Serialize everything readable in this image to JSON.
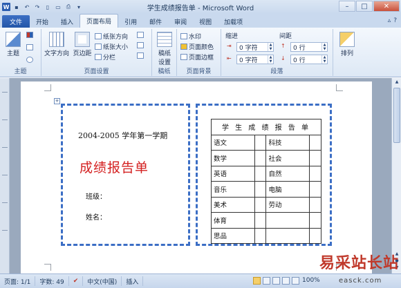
{
  "window": {
    "title": "学生成绩报告单 - Microsoft Word",
    "qat_icons": [
      "word-app-icon",
      "save-icon",
      "undo-icon",
      "redo-icon",
      "new-doc-icon",
      "open-icon",
      "print-preview-icon",
      "customize-qat-icon"
    ]
  },
  "tabs": [
    {
      "label": "文件"
    },
    {
      "label": "开始"
    },
    {
      "label": "插入"
    },
    {
      "label": "页面布局"
    },
    {
      "label": "引用"
    },
    {
      "label": "邮件"
    },
    {
      "label": "审阅"
    },
    {
      "label": "视图"
    },
    {
      "label": "加载项"
    }
  ],
  "ribbon": {
    "themes": {
      "label": "主题",
      "button": "主题"
    },
    "page_setup": {
      "label": "页面设置",
      "text_direction": "文字方向",
      "margins": "页边距",
      "orientation": "纸张方向",
      "size": "纸张大小",
      "columns": "分栏"
    },
    "manuscript": {
      "label": "稿纸",
      "button_line1": "稿纸",
      "button_line2": "设置"
    },
    "page_background": {
      "label": "页面背景",
      "watermark": "水印",
      "page_color": "页面颜色",
      "page_borders": "页面边框"
    },
    "paragraph": {
      "label": "段落",
      "indent": "缩进",
      "spacing": "间距",
      "indent_left": "0 字符",
      "indent_right": "0 字符",
      "spacing_before": "0 行",
      "spacing_after": "0 行"
    },
    "arrange": {
      "button": "排列"
    }
  },
  "document": {
    "cover": {
      "year": "2004-2005 学年第一学期",
      "title": "成绩报告单",
      "class_label": "班级：",
      "name_label": "姓名："
    },
    "table": {
      "header": "学 生 成 绩 报 告 单",
      "rows": [
        [
          "语文",
          "",
          "科技",
          ""
        ],
        [
          "数学",
          "",
          "社会",
          ""
        ],
        [
          "英语",
          "",
          "自然",
          ""
        ],
        [
          "音乐",
          "",
          "电脑",
          ""
        ],
        [
          "美术",
          "",
          "劳动",
          ""
        ],
        [
          "体育",
          "",
          "",
          ""
        ],
        [
          "思品",
          "",
          "",
          ""
        ]
      ]
    }
  },
  "statusbar": {
    "page": "页面: 1/1",
    "words": "字数: 49",
    "language": "中文(中国)",
    "mode": "插入",
    "zoom": "100%"
  },
  "watermark": {
    "text": "易采站长站",
    "url": "easck.com"
  },
  "colors": {
    "accent": "#2356a8",
    "cover_title": "#d42020",
    "dash_border": "#3b6ec5"
  }
}
